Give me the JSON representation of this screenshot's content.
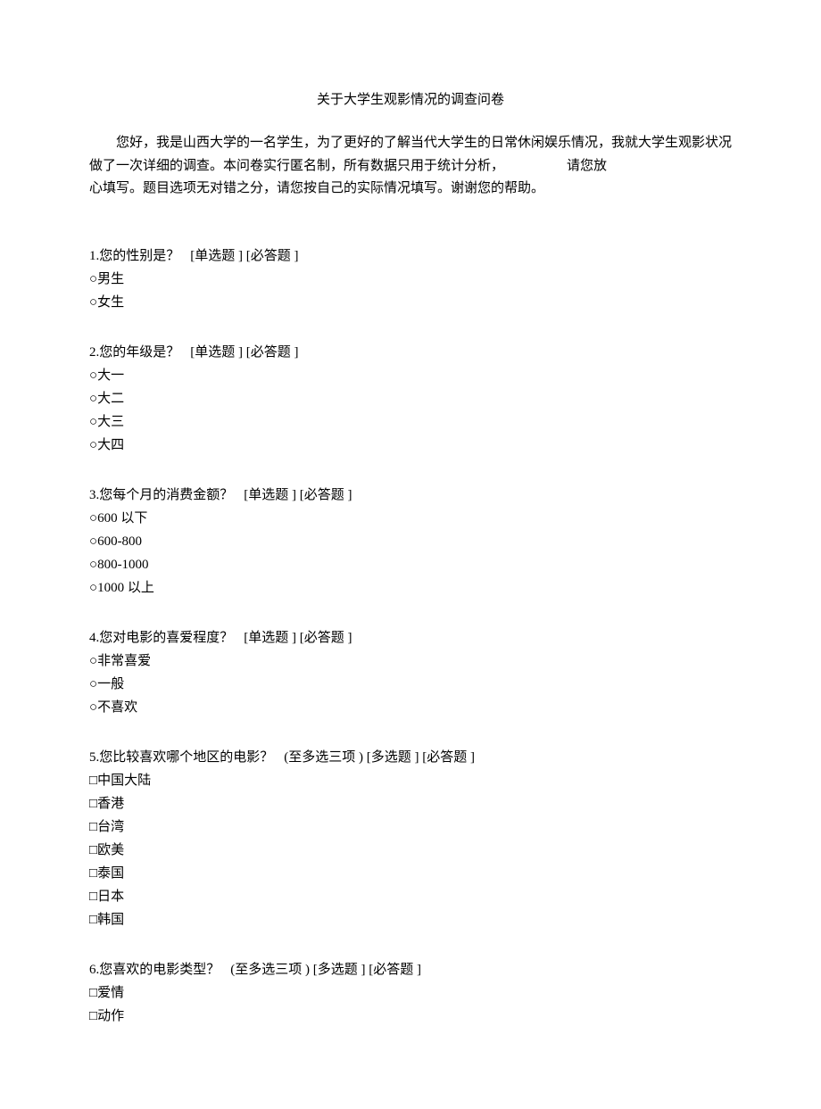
{
  "title": "关于大学生观影情况的调查问卷",
  "intro": {
    "part1": "您好，我是山西大学的一名学生，为了更好的了解当代大学生的日常休闲娱乐情况，我就大学生观影状况做了一次详细的调查。本问卷实行匿名制，所有数据只用于统计分析，",
    "trailing": "请您放",
    "part2": "心填写。题目选项无对错之分，请您按自己的实际情况填写。谢谢您的帮助。"
  },
  "tags": {
    "single": "[单选题 ]",
    "multi": "[多选题 ]",
    "required": "[必答题 ]",
    "hint_max3": "(至多选三项 )"
  },
  "markers": {
    "radio": "○",
    "checkbox": "□"
  },
  "q1": {
    "num": "1.",
    "text": "您的性别是？",
    "o1": "男生",
    "o2": "女生"
  },
  "q2": {
    "num": "2.",
    "text": "您的年级是？",
    "o1": "大一",
    "o2": "大二",
    "o3": "大三",
    "o4": "大四"
  },
  "q3": {
    "num": "3.",
    "text": "您每个月的消费金额？",
    "o1": "600 以下",
    "o2": "600-800",
    "o3": "800-1000",
    "o4": "1000 以上"
  },
  "q4": {
    "num": "4.",
    "text": "您对电影的喜爱程度？",
    "o1": "非常喜爱",
    "o2": "一般",
    "o3": "不喜欢"
  },
  "q5": {
    "num": "5.",
    "text": "您比较喜欢哪个地区的电影？",
    "o1": "中国大陆",
    "o2": "香港",
    "o3": "台湾",
    "o4": "欧美",
    "o5": "泰国",
    "o6": "日本",
    "o7": "韩国"
  },
  "q6": {
    "num": "6.",
    "text": "您喜欢的电影类型？",
    "o1": "爱情",
    "o2": "动作"
  }
}
